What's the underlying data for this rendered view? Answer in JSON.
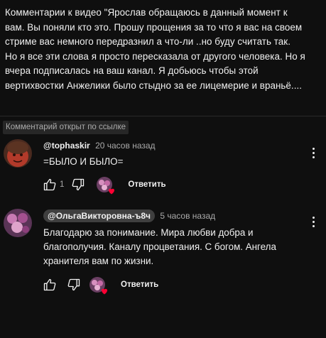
{
  "video_comment": {
    "lines": [
      "Комментарии к видео \"Ярослав обращаюсь в данный момент к",
      "вам. Вы поняли кто это. Прошу прощения за то что я вас на своем",
      "стриме вас немного передразнил а что-ли ..но буду считать так.",
      "Но я все эти слова я просто пересказала от другого человека. Но я",
      "вчера подписалась на ваш канал. Я добьюсь чтобы этой",
      "вертихвостки Анжелики было стыдно за ее лицемерие и враньё...."
    ]
  },
  "linked_badge": "Комментарий открыт по ссылке",
  "comments": [
    {
      "author": "@tophaskir",
      "time": "20 часов назад",
      "text_lines": [
        "=БЫЛО И БЫЛО="
      ],
      "like_count": "1",
      "reply_label": "Ответить",
      "avatar_icon": "red-face-avatar",
      "creator_heart": true
    },
    {
      "author": "@ОльгаВикторовна-ъ8ч",
      "time": "5 часов назад",
      "text_lines": [
        "Благодарю за понимание. Мира любви добра и",
        "благополучия. Каналу процветания. С богом. Ангела",
        "хранителя вам по жизни."
      ],
      "like_count": "",
      "reply_label": "Ответить",
      "avatar_icon": "flowers-avatar",
      "creator_heart": true
    }
  ],
  "colors": {
    "background": "#0f0f0f",
    "text": "#f1f1f1",
    "muted": "#aaaaaa",
    "chip": "#3f3f3f",
    "heart": "#ff0033"
  }
}
